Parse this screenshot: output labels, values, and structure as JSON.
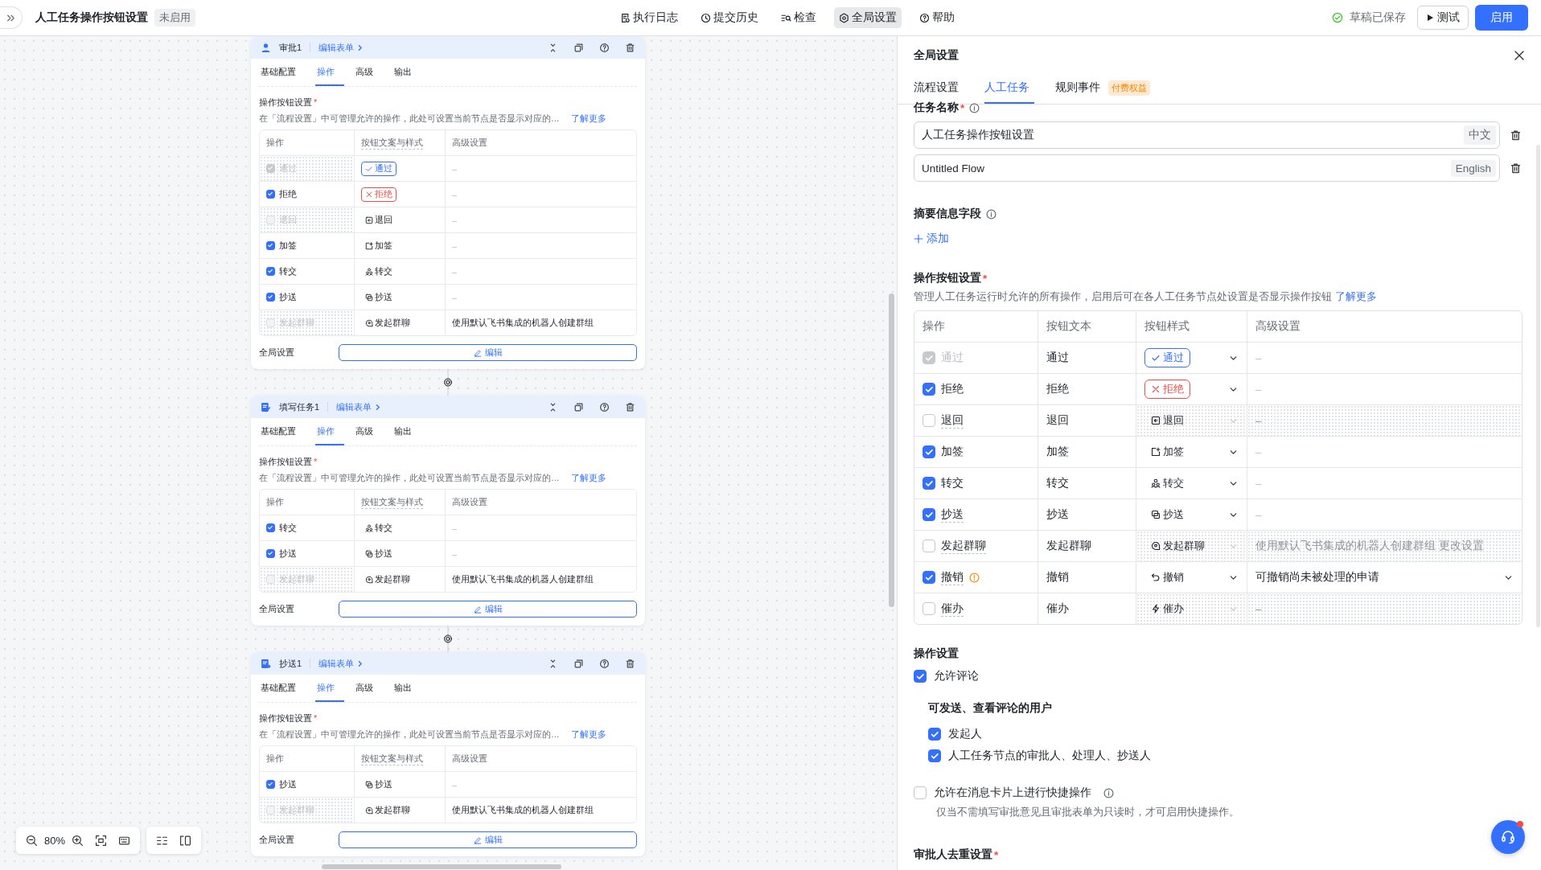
{
  "topbar": {
    "title": "人工任务操作按钮设置",
    "status": "未启用",
    "nav": [
      {
        "kind": "log",
        "label": "执行日志",
        "selected": false
      },
      {
        "kind": "history",
        "label": "提交历史",
        "selected": false
      },
      {
        "kind": "check",
        "label": "检查",
        "selected": false
      },
      {
        "kind": "settings",
        "label": "全局设置",
        "selected": true
      },
      {
        "kind": "help",
        "label": "帮助",
        "selected": false
      }
    ],
    "saved": "草稿已保存",
    "test_button": "测试",
    "enable_button": "启用"
  },
  "canvas": {
    "zoom": "80%",
    "cards": [
      {
        "kind": "approve",
        "title": "审批1",
        "link": "编辑表单",
        "tabs": [
          {
            "label": "基础配置",
            "selected": false
          },
          {
            "label": "操作",
            "selected": true
          },
          {
            "label": "高级",
            "selected": false
          },
          {
            "label": "输出",
            "selected": false
          }
        ],
        "section": "操作按钮设置",
        "required": "*",
        "description": "在「流程设置」中可管理允许的操作，此处可设置当前节点是否显示对应的…",
        "learn_more": "了解更多",
        "columns": [
          "操作",
          "按钮文案与样式",
          "高级设置"
        ],
        "rows": [
          {
            "kind": "approve",
            "label": "通过",
            "checked": true,
            "disabled": true,
            "button": "通过",
            "advanced": "–"
          },
          {
            "kind": "reject",
            "label": "拒绝",
            "checked": true,
            "disabled": false,
            "button": "拒绝",
            "advanced": "–"
          },
          {
            "kind": "return",
            "label": "退回",
            "checked": false,
            "disabled": true,
            "button": "退回",
            "advanced": "–"
          },
          {
            "kind": "add_sign",
            "label": "加签",
            "checked": true,
            "disabled": false,
            "button": "加签",
            "advanced": "–"
          },
          {
            "kind": "transfer",
            "label": "转交",
            "checked": true,
            "disabled": false,
            "button": "转交",
            "advanced": "–"
          },
          {
            "kind": "cc",
            "label": "抄送",
            "checked": true,
            "disabled": false,
            "button": "抄送",
            "advanced": "–"
          },
          {
            "kind": "group_chat",
            "label": "发起群聊",
            "checked": false,
            "disabled": true,
            "button": "发起群聊",
            "advanced": "使用默认飞书集成的机器人创建群组"
          }
        ],
        "footer_label": "全局设置",
        "edit_button": "编辑"
      },
      {
        "kind": "fill",
        "title": "填写任务1",
        "link": "编辑表单",
        "tabs": [
          {
            "label": "基础配置",
            "selected": false
          },
          {
            "label": "操作",
            "selected": true
          },
          {
            "label": "高级",
            "selected": false
          },
          {
            "label": "输出",
            "selected": false
          }
        ],
        "section": "操作按钮设置",
        "required": "*",
        "description": "在「流程设置」中可管理允许的操作，此处可设置当前节点是否显示对应的…",
        "learn_more": "了解更多",
        "columns": [
          "操作",
          "按钮文案与样式",
          "高级设置"
        ],
        "rows": [
          {
            "kind": "transfer",
            "label": "转交",
            "checked": true,
            "disabled": false,
            "button": "转交",
            "advanced": "–"
          },
          {
            "kind": "cc",
            "label": "抄送",
            "checked": true,
            "disabled": false,
            "button": "抄送",
            "advanced": "–"
          },
          {
            "kind": "group_chat",
            "label": "发起群聊",
            "checked": false,
            "disabled": true,
            "button": "发起群聊",
            "advanced": "使用默认飞书集成的机器人创建群组"
          }
        ],
        "footer_label": "全局设置",
        "edit_button": "编辑"
      },
      {
        "kind": "cc",
        "title": "抄送1",
        "link": "编辑表单",
        "tabs": [
          {
            "label": "基础配置",
            "selected": false
          },
          {
            "label": "操作",
            "selected": true
          },
          {
            "label": "高级",
            "selected": false
          },
          {
            "label": "输出",
            "selected": false
          }
        ],
        "section": "操作按钮设置",
        "required": "*",
        "description": "在「流程设置」中可管理允许的操作，此处可设置当前节点是否显示对应的…",
        "learn_more": "了解更多",
        "columns": [
          "操作",
          "按钮文案与样式",
          "高级设置"
        ],
        "rows": [
          {
            "kind": "cc",
            "label": "抄送",
            "checked": true,
            "disabled": false,
            "button": "抄送",
            "advanced": "–"
          },
          {
            "kind": "group_chat",
            "label": "发起群聊",
            "checked": false,
            "disabled": true,
            "button": "发起群聊",
            "advanced": "使用默认飞书集成的机器人创建群组"
          }
        ],
        "footer_label": "全局设置",
        "edit_button": "编辑"
      }
    ]
  },
  "panel": {
    "title": "全局设置",
    "tabs": [
      {
        "label": "流程设置",
        "selected": false
      },
      {
        "label": "人工任务",
        "selected": true
      },
      {
        "label": "规则事件",
        "selected": false,
        "badge": "付费权益"
      }
    ],
    "task_name": {
      "label": "任务名称",
      "required": "*",
      "names": [
        {
          "value": "人工任务操作按钮设置",
          "lang": "中文"
        },
        {
          "value": "Untitled Flow",
          "lang": "English"
        }
      ]
    },
    "summary": {
      "label": "摘要信息字段",
      "add": "添加"
    },
    "buttons": {
      "label": "操作按钮设置",
      "required": "*",
      "description": "管理人工任务运行时允许的所有操作，启用后可在各人工任务节点处设置是否显示操作按钮",
      "learn_more": "了解更多",
      "columns": [
        "操作",
        "按钮文本",
        "按钮样式",
        "高级设置"
      ],
      "rows": [
        {
          "kind": "approve",
          "label": "通过",
          "checked": true,
          "disabled": true,
          "warning": false,
          "text": "通过",
          "button": "通过",
          "advanced": "–",
          "advanced_dropdown": false
        },
        {
          "kind": "reject",
          "label": "拒绝",
          "checked": true,
          "disabled": false,
          "warning": false,
          "text": "拒绝",
          "button": "拒绝",
          "advanced": "–",
          "advanced_dropdown": false
        },
        {
          "kind": "return",
          "label": "退回",
          "checked": false,
          "disabled": false,
          "warning": false,
          "text": "退回",
          "button": "退回",
          "advanced": "–",
          "advanced_dropdown": false
        },
        {
          "kind": "add_sign",
          "label": "加签",
          "checked": true,
          "disabled": false,
          "warning": false,
          "text": "加签",
          "button": "加签",
          "advanced": "–",
          "advanced_dropdown": false
        },
        {
          "kind": "transfer",
          "label": "转交",
          "checked": true,
          "disabled": false,
          "warning": false,
          "text": "转交",
          "button": "转交",
          "advanced": "–",
          "advanced_dropdown": false
        },
        {
          "kind": "cc",
          "label": "抄送",
          "checked": true,
          "disabled": false,
          "warning": false,
          "text": "抄送",
          "button": "抄送",
          "advanced": "–",
          "advanced_dropdown": false
        },
        {
          "kind": "group_chat",
          "label": "发起群聊",
          "checked": false,
          "disabled": false,
          "warning": false,
          "text": "发起群聊",
          "button": "发起群聊",
          "advanced": "使用默认飞书集成的机器人创建群组",
          "advanced_link": "更改设置",
          "advanced_dropdown": false
        },
        {
          "kind": "withdraw",
          "label": "撤销",
          "checked": true,
          "disabled": false,
          "warning": true,
          "text": "撤销",
          "button": "撤销",
          "advanced": "可撤销尚未被处理的申请",
          "advanced_dropdown": true
        },
        {
          "kind": "urge",
          "label": "催办",
          "checked": false,
          "disabled": false,
          "warning": false,
          "text": "催办",
          "button": "催办",
          "advanced": "–",
          "advanced_dropdown": false
        }
      ]
    },
    "operations": {
      "label": "操作设置",
      "allow_comment": {
        "label": "允许评论",
        "checked": true
      },
      "users_heading": "可发送、查看评论的用户",
      "users": [
        {
          "label": "发起人",
          "checked": true
        },
        {
          "label": "人工任务节点的审批人、处理人、抄送人",
          "checked": true
        }
      ],
      "quick": {
        "label": "允许在消息卡片上进行快捷操作",
        "checked": false,
        "hint": "仅当不需填写审批意见且审批表单为只读时，才可启用快捷操作。"
      }
    },
    "dedupe": {
      "label": "审批人去重设置",
      "required": "*"
    }
  }
}
